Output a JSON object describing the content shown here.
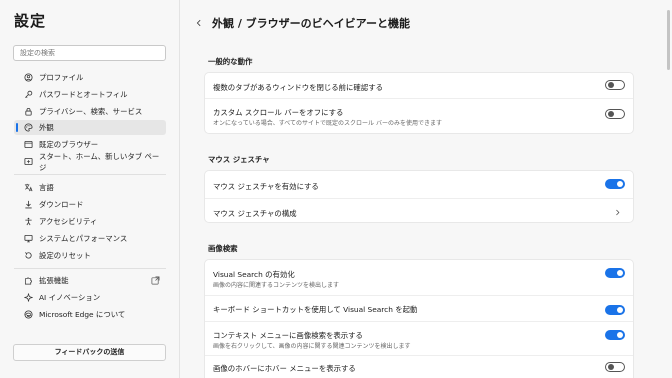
{
  "sidebar": {
    "title": "設定",
    "search_placeholder": "設定の検索",
    "items": [
      {
        "label": "プロファイル"
      },
      {
        "label": "パスワードとオートフィル"
      },
      {
        "label": "プライバシー、検索、サービス"
      },
      {
        "label": "外観"
      },
      {
        "label": "既定のブラウザー"
      },
      {
        "label": "スタート、ホーム、新しいタブ ページ"
      },
      {
        "label": "言語"
      },
      {
        "label": "ダウンロード"
      },
      {
        "label": "アクセシビリティ"
      },
      {
        "label": "システムとパフォーマンス"
      },
      {
        "label": "設定のリセット"
      },
      {
        "label": "拡張機能"
      },
      {
        "label": "AI イノベーション"
      },
      {
        "label": "Microsoft Edge について"
      }
    ],
    "feedback_label": "フィードバックの送信"
  },
  "main": {
    "title": "外観 / ブラウザーのビヘイビアーと機能",
    "sections": [
      {
        "title": "一般的な動作",
        "rows": [
          {
            "label": "複数のタブがあるウィンドウを閉じる前に確認する",
            "toggle": false
          },
          {
            "label": "カスタム スクロール バーをオフにする",
            "description": "オンになっている場合、すべてのサイトで既定のスクロール バーのみを使用できます",
            "toggle": false
          }
        ]
      },
      {
        "title": "マウス ジェスチャ",
        "rows": [
          {
            "label": "マウス ジェスチャを有効にする",
            "toggle": true
          },
          {
            "label": "マウス ジェスチャの構成"
          }
        ]
      },
      {
        "title": "画像検索",
        "rows": [
          {
            "label": "Visual Search の有効化",
            "description": "画像の内容に関連するコンテンツを検出します",
            "toggle": true
          },
          {
            "label": "キーボード ショートカットを使用して Visual Search を起動",
            "toggle": true
          },
          {
            "label": "コンテキスト メニューに画像検索を表示する",
            "description": "画像を右クリックして、画像の内容に関する関連コンテンツを検出します",
            "toggle": true
          },
          {
            "label": "画像のホバーにホバー メニューを表示する",
            "toggle": false
          }
        ]
      }
    ]
  },
  "colors": {
    "accent": "#1a73e8",
    "background": "#f7f7f7",
    "card": "#ffffff"
  }
}
